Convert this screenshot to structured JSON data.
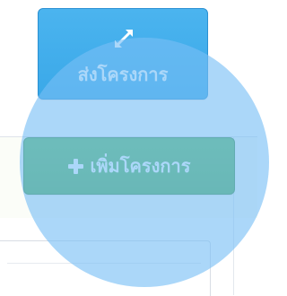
{
  "buttons": {
    "submit_label": "ส่งโครงการ",
    "add_label": "เพิ่มโครงการ"
  },
  "icons": {
    "expand": "expand-arrows-icon",
    "plus": "plus-icon"
  },
  "colors": {
    "submit_button": "#3aa8e8",
    "add_button": "#52ad52",
    "overlay": "#78bef5"
  }
}
